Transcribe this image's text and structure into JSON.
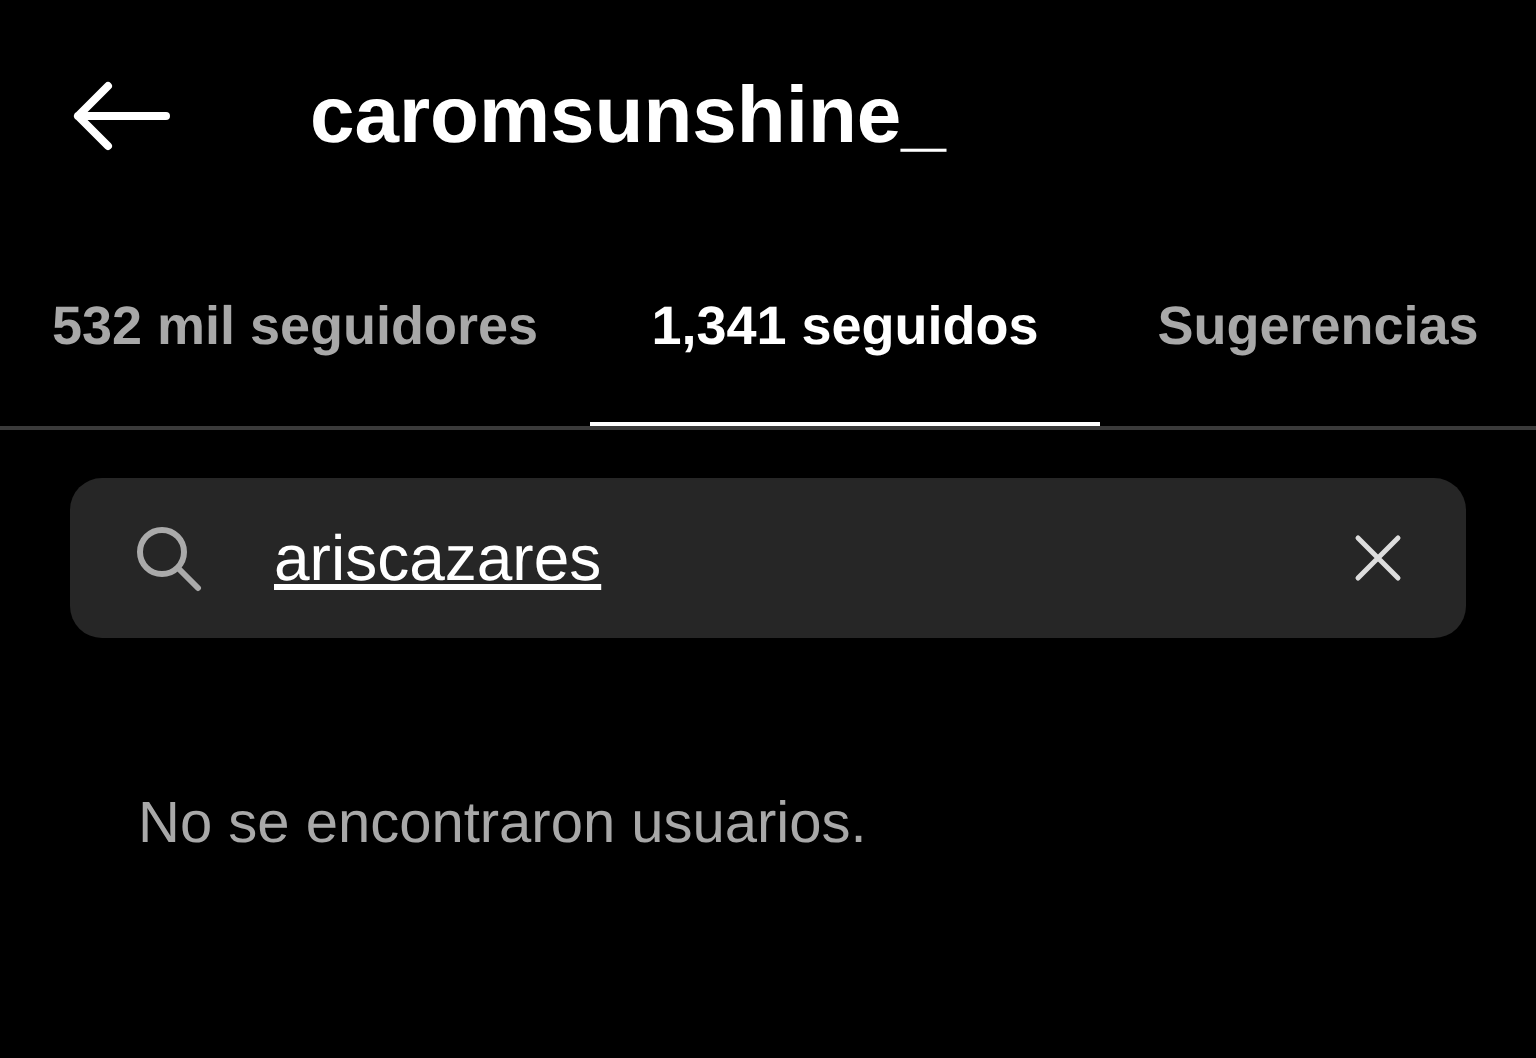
{
  "header": {
    "title": "caromsunshine_"
  },
  "tabs": [
    {
      "label": "532 mil seguidores",
      "selected": false
    },
    {
      "label": "1,341 seguidos",
      "selected": true
    },
    {
      "label": "Sugerencias",
      "selected": false
    }
  ],
  "search": {
    "value": "ariscazares"
  },
  "message": "No se encontraron usuarios."
}
